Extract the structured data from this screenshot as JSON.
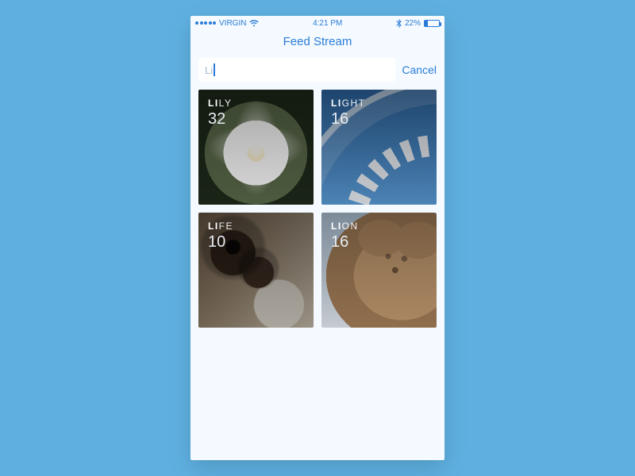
{
  "status": {
    "carrier": "VIRGIN",
    "time": "4:21 PM",
    "battery_pct": "22%"
  },
  "header": {
    "title": "Feed Stream"
  },
  "search": {
    "value": "Li",
    "cancel_label": "Cancel"
  },
  "tiles": [
    {
      "prefix": "LI",
      "suffix": "LY",
      "count": "32",
      "art": "art-lily"
    },
    {
      "prefix": "LI",
      "suffix": "GHT",
      "count": "16",
      "art": "art-light"
    },
    {
      "prefix": "LI",
      "suffix": "FE",
      "count": "10",
      "art": "art-life"
    },
    {
      "prefix": "LI",
      "suffix": "ON",
      "count": "16",
      "art": "art-lion"
    }
  ]
}
